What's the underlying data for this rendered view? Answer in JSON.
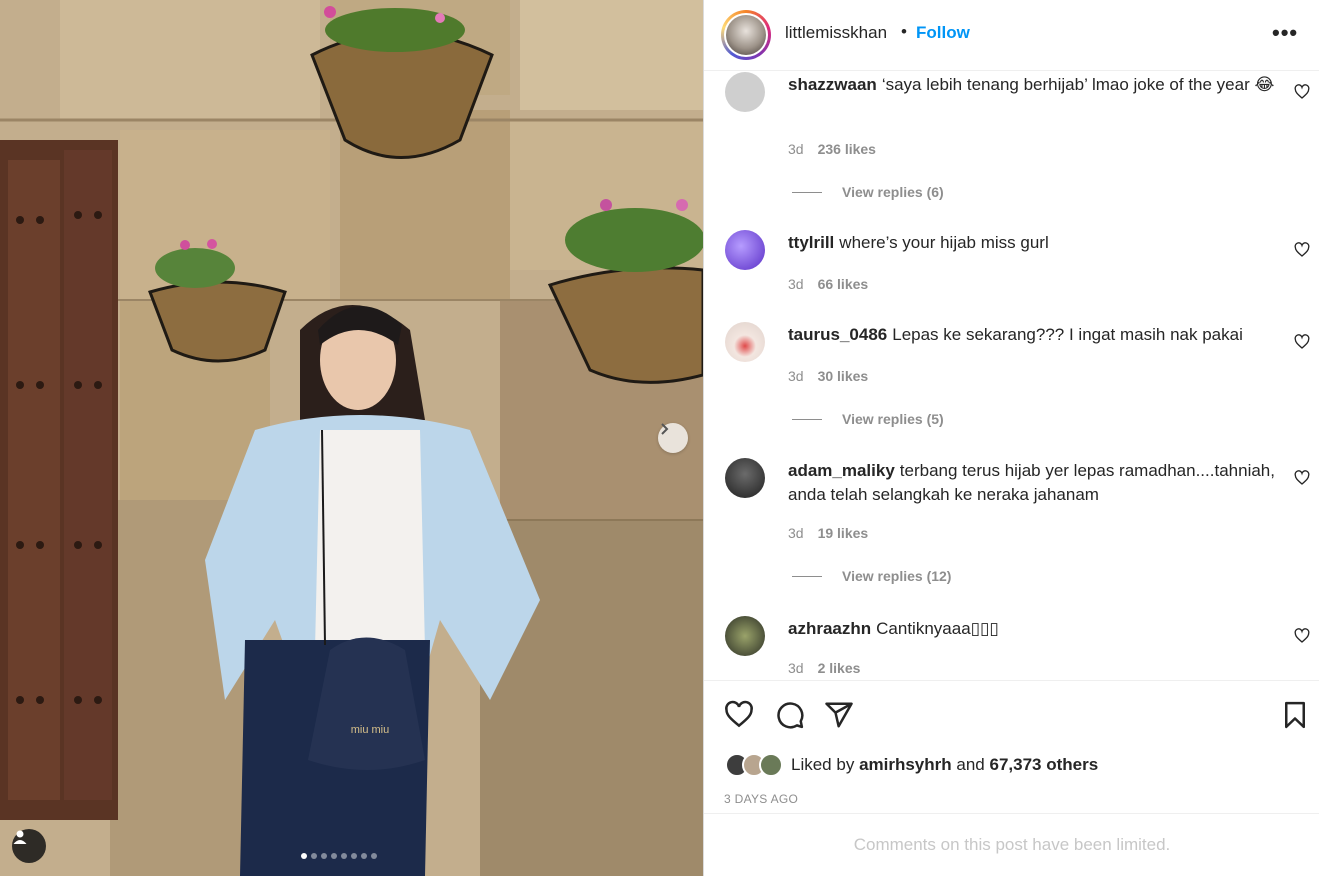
{
  "post": {
    "image_dots": 8,
    "active_dot": 0
  },
  "header": {
    "username": "littlemisskhan",
    "separator": "•",
    "follow_label": "Follow",
    "more_label": "•••"
  },
  "comments": [
    {
      "username": "shazzwaan",
      "text": "‘saya lebih tenang berhijab’ lmao joke of the year 😂",
      "age": "3d",
      "likes": "236 likes",
      "replies": "View replies (6)",
      "avatar_color": "#d6d6d6"
    },
    {
      "username": "ttylrill",
      "text": "where’s your hijab miss gurl",
      "age": "3d",
      "likes": "66 likes",
      "replies": "",
      "avatar_color": "#7a4fd1"
    },
    {
      "username": "taurus_0486",
      "text": "Lepas ke sekarang??? I ingat masih nak pakai",
      "age": "3d",
      "likes": "30 likes",
      "replies": "View replies (5)",
      "avatar_color": "#e9dcd6"
    },
    {
      "username": "adam_maliky",
      "text": "terbang terus hijab yer lepas ramadhan....tahniah, anda telah selangkah ke neraka jahanam",
      "age": "3d",
      "likes": "19 likes",
      "replies": "View replies (12)",
      "avatar_color": "#3a3a3a"
    },
    {
      "username": "azhraazhn",
      "text": "Cantiknyaaa▯▯▯",
      "age": "3d",
      "likes": "2 likes",
      "replies": "",
      "avatar_color": "#5b6b3f"
    }
  ],
  "actions": {
    "like_icon": "heart-icon",
    "comment_icon": "comment-icon",
    "share_icon": "share-icon",
    "save_icon": "bookmark-icon"
  },
  "likes_summary": {
    "prefix": "Liked by",
    "user": "amirhsyhrh",
    "and": "and",
    "others": "67,373 others"
  },
  "date": "3 DAYS AGO",
  "limited_text": "Comments on this post have been limited.",
  "colors": {
    "accent": "#0095f6",
    "muted": "#8e8e8e",
    "text": "#262626"
  }
}
